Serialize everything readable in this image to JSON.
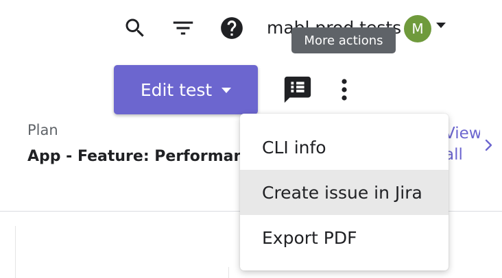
{
  "header": {
    "workspace_name": "mabl prod tests",
    "avatar_initial": "M",
    "icons": {
      "search": "search-icon",
      "filter": "filter-icon",
      "help": "help-icon",
      "account_menu": "caret-down-icon"
    }
  },
  "tooltip": {
    "text": "More actions"
  },
  "toolbar": {
    "edit_test_label": "Edit test",
    "comments_icon": "comments-icon",
    "more_actions_icon": "more-vertical-icon"
  },
  "plan": {
    "label": "Plan",
    "name": "App - Feature: Performance",
    "view_all_label": "View all"
  },
  "menu": {
    "items": [
      {
        "label": "CLI info"
      },
      {
        "label": "Create issue in Jira"
      },
      {
        "label": "Export PDF"
      }
    ]
  },
  "colors": {
    "accent": "#6c66cf",
    "avatar": "#6f9a3c",
    "tooltip_bg": "#5f6368",
    "menu_hover": "#e8e8e8"
  }
}
